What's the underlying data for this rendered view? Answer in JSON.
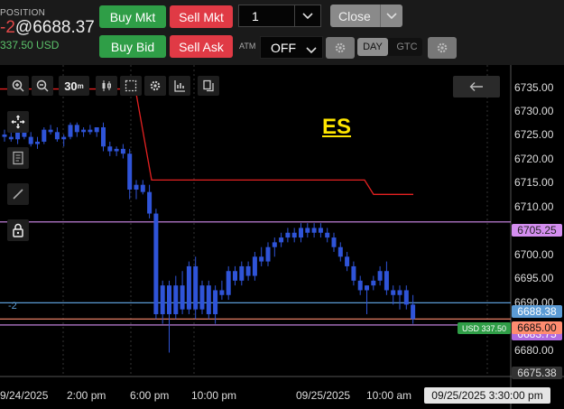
{
  "position": {
    "label": "POSITION",
    "qty": "-2",
    "price": "@6688.37",
    "pnl": "337.50 USD"
  },
  "order_buttons": {
    "buy_mkt": "Buy Mkt",
    "sell_mkt": "Sell Mkt",
    "buy_bid": "Buy Bid",
    "sell_ask": "Sell Ask"
  },
  "quantity": {
    "value": "1"
  },
  "close_button": {
    "label": "Close"
  },
  "atm": {
    "label": "ATM",
    "value": "OFF"
  },
  "time_in_force": {
    "day": "DAY",
    "gtc": "GTC"
  },
  "toolbar": {
    "timeframe": "30",
    "timeframe_unit": "m"
  },
  "chart": {
    "symbol": "ES",
    "position_qty_label": "-2",
    "pnl_tag": "USD 337.50",
    "y_ticks": [
      "6735.00",
      "6730.00",
      "6725.00",
      "6720.00",
      "6715.00",
      "6710.00",
      "6700.00",
      "6695.00",
      "6690.00",
      "6680.00"
    ],
    "price_tags": {
      "level_high": "6705.25",
      "entry": "6688.38",
      "last": "6685.00",
      "level_low": "6683.75",
      "bottom": "6675.38"
    },
    "x_ticks": [
      "9/24/2025",
      "2:00 pm",
      "6:00 pm",
      "10:00 pm",
      "09/25/2025",
      "10:00 am"
    ],
    "crosshair_time": "09/25/2025 3:30:00 pm",
    "colors": {
      "candle": "#2f54d8",
      "stop_line": "#e52121",
      "level_line": "#d48ef0",
      "entry_line": "#5b9bd5",
      "last_line": "#ff8c70"
    }
  },
  "chart_data": {
    "type": "candlestick",
    "ylim": [
      6673,
      6738
    ],
    "x_labels": [
      "9/24/2025",
      "2:00 pm",
      "6:00 pm",
      "10:00 pm",
      "09/25/2025",
      "10:00 am"
    ],
    "series": [
      {
        "values": [
          [
            6723.5,
            6724.5,
            6722,
            6723
          ],
          [
            6723,
            6724,
            6722,
            6722.5
          ],
          [
            6722.5,
            6724.5,
            6721.5,
            6724
          ],
          [
            6724,
            6725,
            6722.5,
            6723
          ],
          [
            6723,
            6724,
            6721,
            6721.5
          ],
          [
            6721.5,
            6723,
            6720.5,
            6722
          ],
          [
            6722,
            6725,
            6721.5,
            6724.5
          ],
          [
            6724.5,
            6725.5,
            6723.5,
            6724
          ],
          [
            6724,
            6725,
            6722,
            6722.5
          ],
          [
            6722.5,
            6723.5,
            6721,
            6723
          ],
          [
            6723,
            6726,
            6722.5,
            6725.5
          ],
          [
            6725.5,
            6726,
            6723,
            6724
          ],
          [
            6724,
            6725,
            6723,
            6724.5
          ],
          [
            6724.5,
            6725.5,
            6723.5,
            6724
          ],
          [
            6724,
            6725,
            6723,
            6725
          ],
          [
            6725,
            6726,
            6720,
            6721
          ],
          [
            6721,
            6722,
            6719,
            6720
          ],
          [
            6720,
            6721,
            6719,
            6720.5
          ],
          [
            6720.5,
            6721.5,
            6718.5,
            6719.5
          ],
          [
            6719.5,
            6720.5,
            6710,
            6712
          ],
          [
            6712,
            6714,
            6710,
            6713
          ],
          [
            6713,
            6714,
            6711,
            6711.5
          ],
          [
            6711.5,
            6713,
            6706,
            6707
          ],
          [
            6707,
            6708,
            6685,
            6686
          ],
          [
            6686,
            6693,
            6684,
            6692
          ],
          [
            6692,
            6693,
            6678,
            6686
          ],
          [
            6686,
            6694,
            6685,
            6692
          ],
          [
            6692,
            6695,
            6686,
            6687
          ],
          [
            6687,
            6697,
            6686,
            6696
          ],
          [
            6696,
            6698,
            6685,
            6687
          ],
          [
            6687,
            6693,
            6686,
            6692
          ],
          [
            6692,
            6693,
            6685,
            6686
          ],
          [
            6686,
            6692,
            6684,
            6691
          ],
          [
            6691,
            6693,
            6689,
            6690
          ],
          [
            6690,
            6696,
            6689,
            6695
          ],
          [
            6695,
            6696,
            6692,
            6693
          ],
          [
            6693,
            6697,
            6692,
            6696
          ],
          [
            6696,
            6697,
            6693,
            6694
          ],
          [
            6694,
            6699,
            6693,
            6698
          ],
          [
            6698,
            6700,
            6696,
            6697
          ],
          [
            6697,
            6701,
            6696,
            6700
          ],
          [
            6700,
            6702,
            6698,
            6701
          ],
          [
            6701,
            6703,
            6700,
            6702
          ],
          [
            6702,
            6704,
            6701,
            6703
          ],
          [
            6703,
            6704,
            6701,
            6702
          ],
          [
            6702,
            6705,
            6701,
            6704
          ],
          [
            6704,
            6705,
            6702,
            6703
          ],
          [
            6703,
            6705,
            6702,
            6704
          ],
          [
            6704,
            6705,
            6702,
            6703
          ],
          [
            6703,
            6704,
            6701,
            6702
          ],
          [
            6702,
            6703,
            6699,
            6700
          ],
          [
            6700,
            6701,
            6697,
            6698
          ],
          [
            6698,
            6699,
            6695,
            6696
          ],
          [
            6696,
            6697,
            6692,
            6693
          ],
          [
            6693,
            6694,
            6690,
            6691
          ],
          [
            6691,
            6692,
            6686,
            6692
          ],
          [
            6692,
            6694,
            6691,
            6693
          ],
          [
            6693,
            6696,
            6692,
            6695
          ],
          [
            6695,
            6697,
            6690,
            6691
          ],
          [
            6691,
            6692,
            6688,
            6690
          ],
          [
            6690,
            6692,
            6687,
            6691
          ],
          [
            6691,
            6692,
            6687,
            6688
          ],
          [
            6688,
            6690,
            6684,
            6685
          ]
        ]
      }
    ]
  }
}
